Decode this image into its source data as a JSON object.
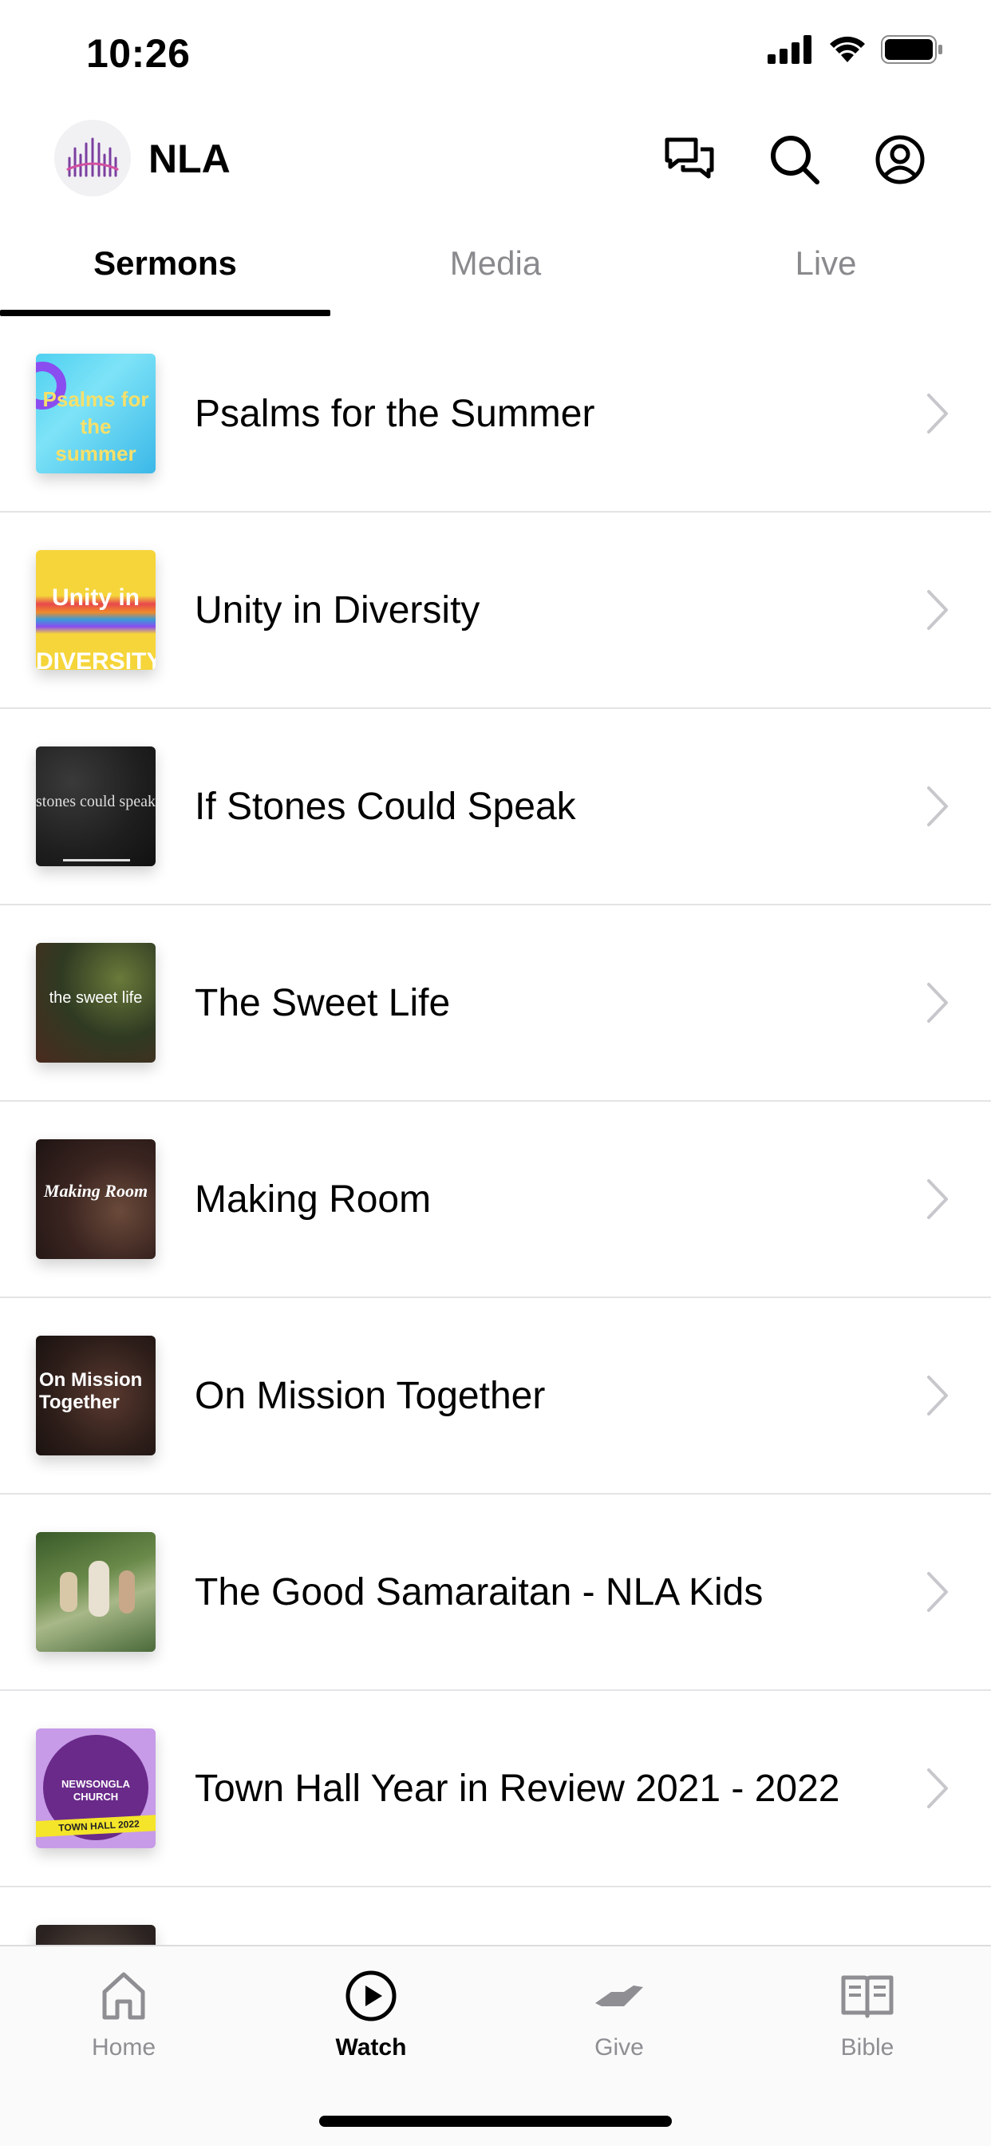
{
  "status_bar": {
    "time": "10:26"
  },
  "header": {
    "title": "NLA",
    "icons": [
      "chat-icon",
      "search-icon",
      "profile-icon"
    ]
  },
  "tabs": [
    {
      "label": "Sermons",
      "active": true
    },
    {
      "label": "Media",
      "active": false
    },
    {
      "label": "Live",
      "active": false
    }
  ],
  "sermons": [
    {
      "title": "Psalms for the Summer",
      "thumb_text": "Psalms for the summer"
    },
    {
      "title": "Unity in Diversity",
      "thumb_text": "Unity in DIVERSITY"
    },
    {
      "title": "If Stones Could Speak",
      "thumb_text": "stones could speak"
    },
    {
      "title": "The Sweet Life",
      "thumb_text": "the sweet life"
    },
    {
      "title": "Making Room",
      "thumb_text": "Making Room"
    },
    {
      "title": "On Mission Together",
      "thumb_text": "On Mission Together"
    },
    {
      "title": "The Good Samaraitan - NLA Kids",
      "thumb_text": ""
    },
    {
      "title": "Town Hall Year in Review 2021 - 2022",
      "thumb_text": "NEWSONGLA CHURCH",
      "thumb_banner": "TOWN HALL 2022"
    }
  ],
  "tabbar": [
    {
      "label": "Home",
      "icon": "home-icon",
      "active": false
    },
    {
      "label": "Watch",
      "icon": "play-icon",
      "active": true
    },
    {
      "label": "Give",
      "icon": "give-icon",
      "active": false
    },
    {
      "label": "Bible",
      "icon": "bible-icon",
      "active": false
    }
  ],
  "colors": {
    "accent": "#000000",
    "inactive": "#8e8e93",
    "divider": "#e4e4e6",
    "logo_purple": "#7b3fa0"
  }
}
